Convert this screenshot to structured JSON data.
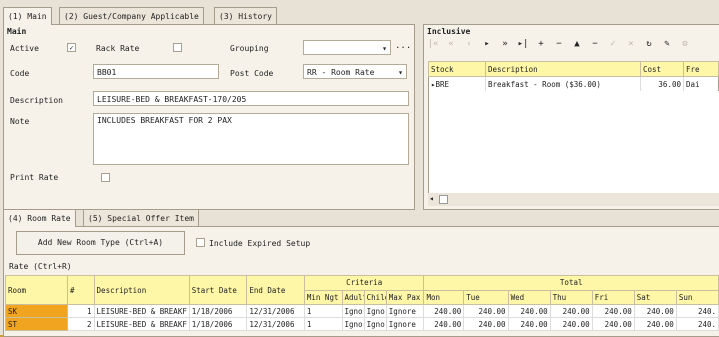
{
  "tabs": [
    "(1) Main",
    "(2) Guest/Company Applicable",
    "(3) History"
  ],
  "main_section": {
    "title": "Main",
    "active_label": "Active",
    "active_checked": true,
    "rack_rate_label": "Rack Rate",
    "grouping_label": "Grouping",
    "grouping_value": "",
    "code_label": "Code",
    "code_value": "BB01",
    "post_code_label": "Post Code",
    "post_code_value": "RR - Room Rate",
    "description_label": "Description",
    "description_value": "LEISURE-BED & BREAKFAST-170/205",
    "note_label": "Note",
    "note_value": "INCLUDES BREAKFAST FOR 2 PAX",
    "print_rate_label": "Print Rate",
    "ellipsis": "..."
  },
  "inclusive": {
    "title": "Inclusive",
    "columns": [
      "Stock",
      "Description",
      "Cost",
      "Fre"
    ],
    "rows": [
      {
        "stock": "BRE",
        "description": "Breakfast - Room ($36.00)",
        "cost": "36.00",
        "freq": "Dai"
      }
    ]
  },
  "lower_tabs": [
    "(4) Room Rate",
    "(5) Special Offer Item"
  ],
  "add_room_type_button": "Add New Room Type (Ctrl+A)",
  "include_expired_label": "Include Expired Setup",
  "rate_title": "Rate (Ctrl+R)",
  "rate_grid": {
    "headers": {
      "room": "Room",
      "num": "#",
      "description": "Description",
      "start_date": "Start Date",
      "end_date": "End Date",
      "criteria": "Criteria",
      "min_ngt": "Min Ngt",
      "adult": "Adult",
      "child": "Child",
      "max_pax": "Max Pax",
      "total": "Total",
      "mon": "Mon",
      "tue": "Tue",
      "wed": "Wed",
      "thu": "Thu",
      "fri": "Fri",
      "sat": "Sat",
      "sun": "Sun"
    },
    "rows": [
      {
        "room": "SK",
        "num": "1",
        "description": "LEISURE-BED & BREAKF",
        "start": "1/18/2006",
        "end": "12/31/2006",
        "min": "1",
        "adult": "Ignor",
        "child": "Ignor",
        "max": "Ignore",
        "mon": "240.00",
        "tue": "240.00",
        "wed": "240.00",
        "thu": "240.00",
        "fri": "240.00",
        "sat": "240.00",
        "sun": "240."
      },
      {
        "room": "ST",
        "num": "2",
        "description": "LEISURE-BED & BREAKF",
        "start": "1/18/2006",
        "end": "12/31/2006",
        "min": "1",
        "adult": "Ignor",
        "child": "Ignor",
        "max": "Ignore",
        "mon": "240.00",
        "tue": "240.00",
        "wed": "240.00",
        "thu": "240.00",
        "fri": "240.00",
        "sat": "240.00",
        "sun": "240."
      }
    ]
  },
  "colors": {
    "accent_orange": "#f0a420",
    "selected_row": "#fff7a8",
    "outer_frame": "#c8a040"
  }
}
